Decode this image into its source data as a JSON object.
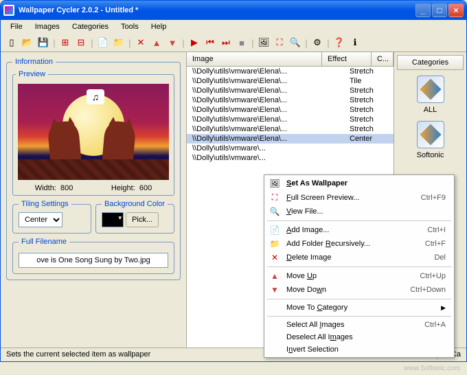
{
  "title": "Wallpaper Cycler 2.0.2 - Untitled *",
  "menus": [
    "File",
    "Images",
    "Categories",
    "Tools",
    "Help"
  ],
  "info_legend": "Information",
  "preview_legend": "Preview",
  "width_label": "Width:",
  "width_val": "800",
  "height_label": "Height:",
  "height_val": "600",
  "tiling_legend": "Tiling Settings",
  "tiling_value": "Center",
  "bg_legend": "Background Color",
  "pick_label": "Pick...",
  "filename_legend": "Full Filename",
  "filename": "ove is One Song Sung by Two.jpg",
  "col_image": "Image",
  "col_effect": "Effect",
  "col_c": "C...",
  "rows": [
    {
      "path": "\\\\Dolly\\utils\\vmware\\Elena\\...",
      "effect": "Stretch"
    },
    {
      "path": "\\\\Dolly\\utils\\vmware\\Elena\\...",
      "effect": "Tile"
    },
    {
      "path": "\\\\Dolly\\utils\\vmware\\Elena\\...",
      "effect": "Stretch"
    },
    {
      "path": "\\\\Dolly\\utils\\vmware\\Elena\\...",
      "effect": "Stretch"
    },
    {
      "path": "\\\\Dolly\\utils\\vmware\\Elena\\...",
      "effect": "Stretch"
    },
    {
      "path": "\\\\Dolly\\utils\\vmware\\Elena\\...",
      "effect": "Stretch"
    },
    {
      "path": "\\\\Dolly\\utils\\vmware\\Elena\\...",
      "effect": "Stretch"
    },
    {
      "path": "\\\\Dolly\\utils\\vmware\\Elena\\...",
      "effect": "Center"
    },
    {
      "path": "\\\\Dolly\\utils\\vmware\\...",
      "effect": ""
    },
    {
      "path": "\\\\Dolly\\utils\\vmware\\...",
      "effect": ""
    }
  ],
  "categories_header": "Categories",
  "cat_all": "ALL",
  "cat_softonic": "Softonic",
  "status_left": "Sets the current selected item as wallpaper",
  "status_right": "In Ca",
  "ctx": {
    "set_wp": "Set As Wallpaper",
    "full_prev": "Full Screen Preview...",
    "full_prev_sc": "Ctrl+F9",
    "view_file": "View File...",
    "add_img": "Add Image...",
    "add_img_sc": "Ctrl+I",
    "add_folder": "Add Folder Recursively...",
    "add_folder_sc": "Ctrl+F",
    "del_img": "Delete Image",
    "del_img_sc": "Del",
    "move_up": "Move Up",
    "move_up_sc": "Ctrl+Up",
    "move_down": "Move Down",
    "move_down_sc": "Ctrl+Down",
    "move_cat": "Move To Category",
    "sel_all": "Select All Images",
    "sel_all_sc": "Ctrl+A",
    "desel_all": "Deselect All Images",
    "invert": "Invert Selection"
  },
  "watermark": "www.Softonic.com"
}
